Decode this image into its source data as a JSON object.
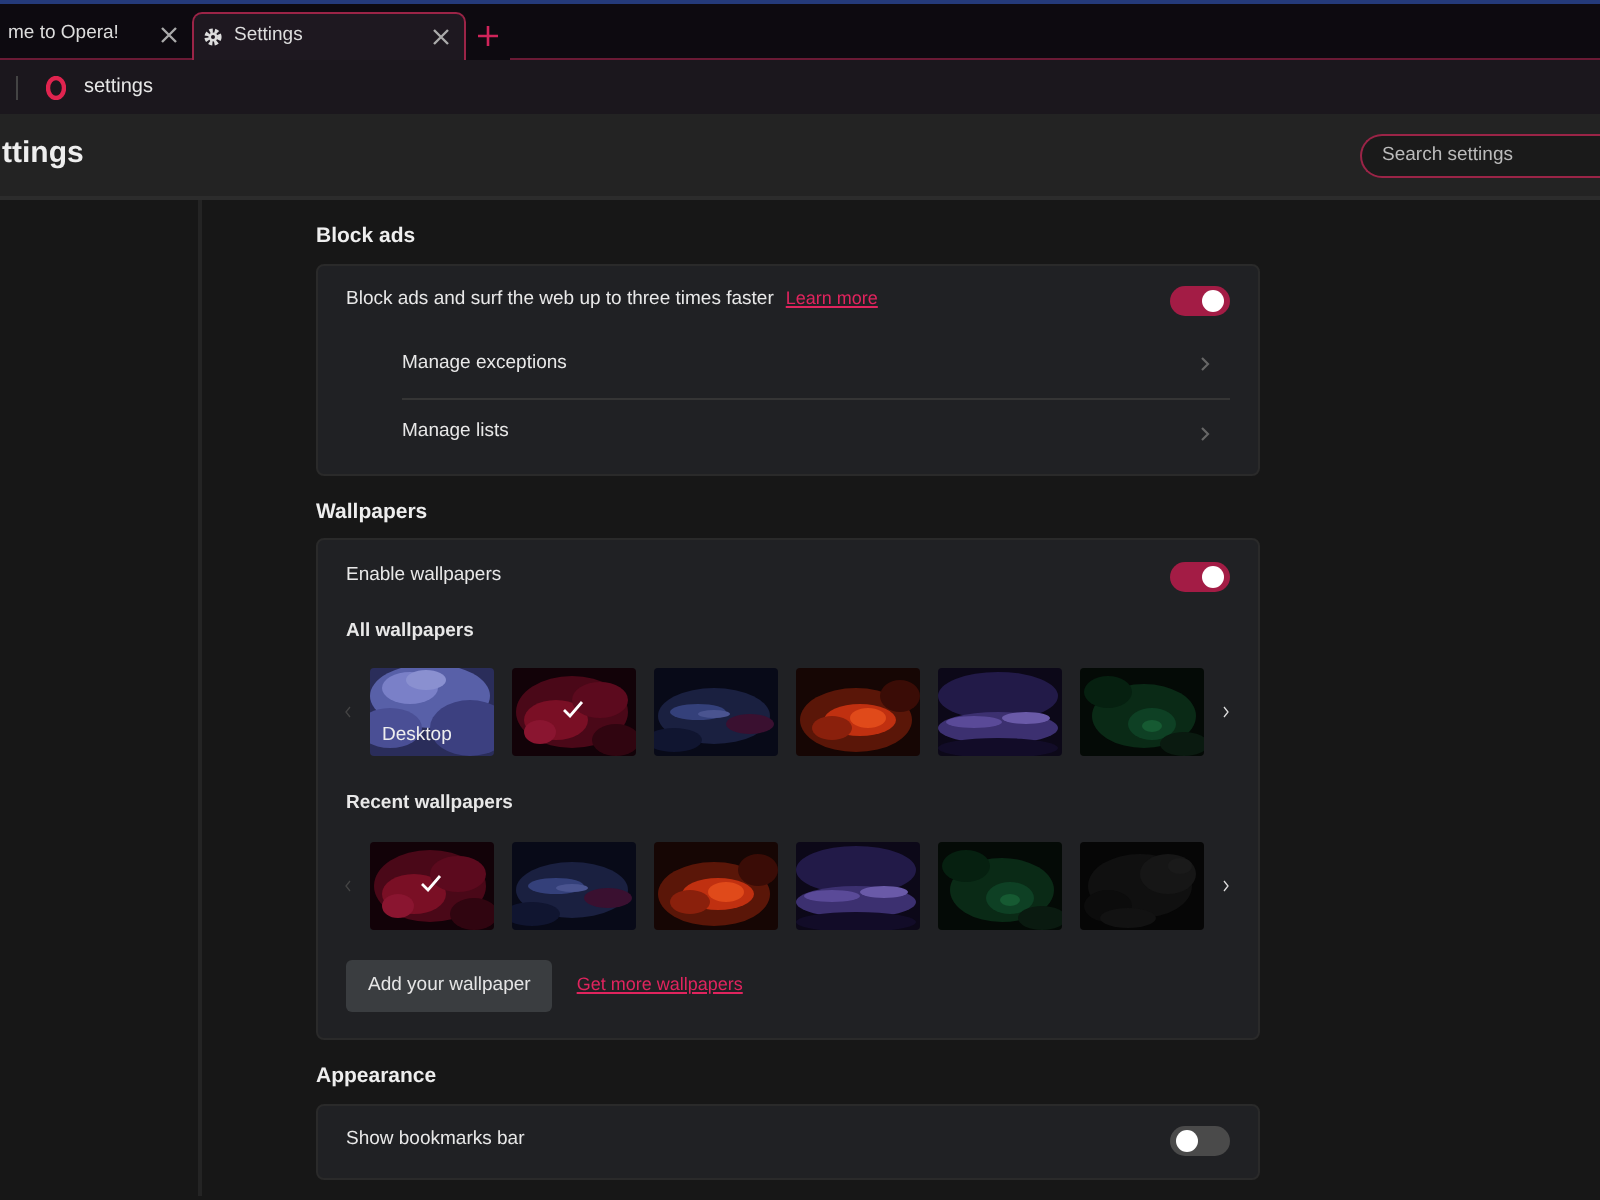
{
  "tabs": [
    {
      "title": "me to Opera!",
      "kind": "page",
      "selected": false
    },
    {
      "title": "Settings",
      "kind": "settings",
      "selected": true
    }
  ],
  "address": {
    "text": "settings"
  },
  "header": {
    "title": "ttings",
    "search": {
      "placeholder": "Search settings"
    }
  },
  "sections": [
    {
      "title": "Block ads",
      "rows": [
        {
          "kind": "toggle",
          "label": "Block ads and surf the web up to three times faster",
          "link": "Learn more",
          "on": true
        },
        {
          "kind": "nav",
          "label": "Manage exceptions"
        },
        {
          "kind": "nav",
          "label": "Manage lists"
        }
      ]
    },
    {
      "title": "Wallpapers",
      "rows": [
        {
          "kind": "toggle",
          "label": "Enable wallpapers",
          "on": true
        },
        {
          "kind": "gallery",
          "label": "All wallpapers",
          "items": [
            {
              "kind": "picture",
              "caption": "Desktop",
              "selected": false
            },
            {
              "kind": "picture",
              "selected": true
            },
            {
              "kind": "picture",
              "selected": false
            },
            {
              "kind": "picture",
              "selected": false
            },
            {
              "kind": "picture",
              "selected": false
            },
            {
              "kind": "picture",
              "selected": false
            }
          ]
        },
        {
          "kind": "gallery",
          "label": "Recent wallpapers",
          "items": [
            {
              "kind": "picture",
              "selected": true
            },
            {
              "kind": "picture",
              "selected": false
            },
            {
              "kind": "picture",
              "selected": false
            },
            {
              "kind": "picture",
              "selected": false
            },
            {
              "kind": "picture",
              "selected": false
            },
            {
              "kind": "picture",
              "selected": false
            }
          ]
        },
        {
          "kind": "actions",
          "button": "Add your wallpaper",
          "link": "Get more wallpapers"
        }
      ]
    },
    {
      "title": "Appearance",
      "rows": [
        {
          "kind": "toggle",
          "label": "Show bookmarks bar",
          "on": false
        }
      ]
    }
  ]
}
